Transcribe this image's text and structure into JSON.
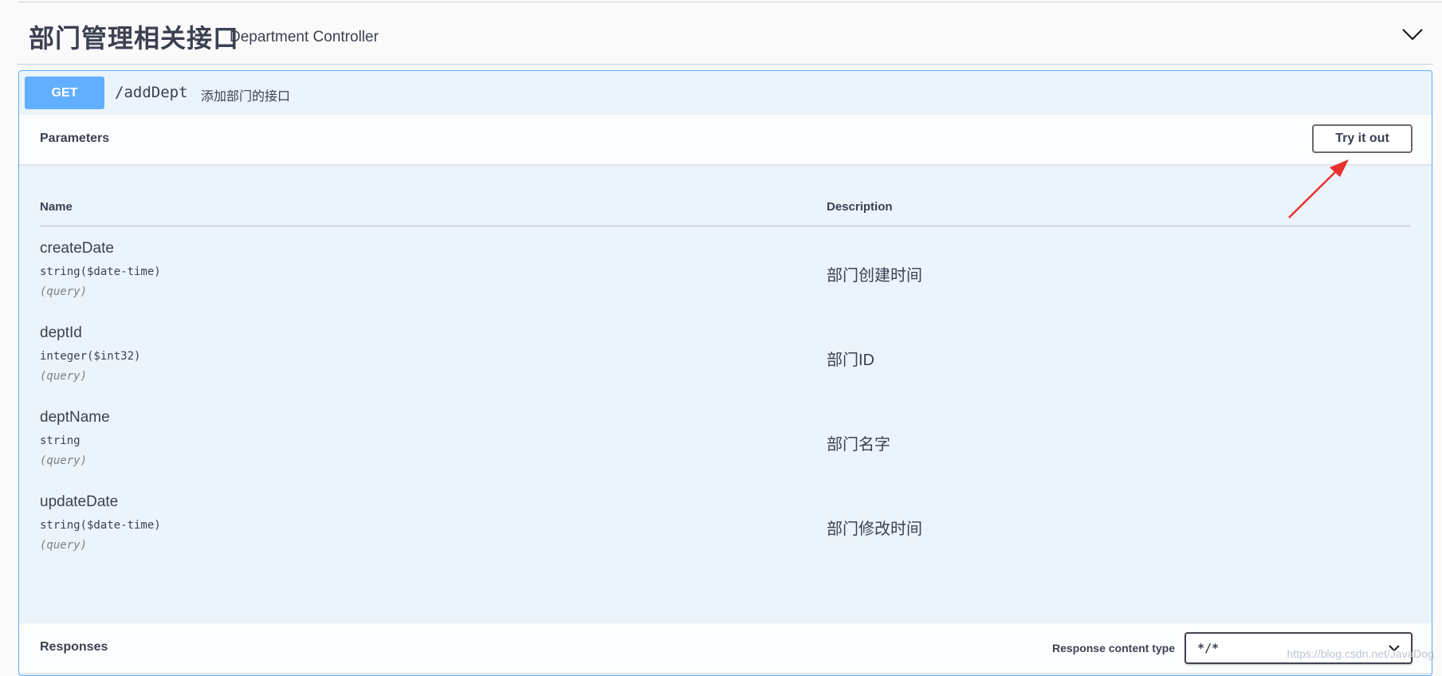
{
  "tag": {
    "title": "部门管理相关接口",
    "description": "Department Controller",
    "chevron_icon": "chevron-down-icon"
  },
  "operation": {
    "method": "GET",
    "path": "/addDept",
    "summary": "添加部门的接口"
  },
  "parameters_section": {
    "title": "Parameters",
    "try_button": "Try it out",
    "columns": {
      "name": "Name",
      "description": "Description"
    },
    "params": [
      {
        "name": "createDate",
        "type": "string($date-time)",
        "in": "(query)",
        "description": "部门创建时间"
      },
      {
        "name": "deptId",
        "type": "integer($int32)",
        "in": "(query)",
        "description": "部门ID"
      },
      {
        "name": "deptName",
        "type": "string",
        "in": "(query)",
        "description": "部门名字"
      },
      {
        "name": "updateDate",
        "type": "string($date-time)",
        "in": "(query)",
        "description": "部门修改时间"
      }
    ]
  },
  "responses_section": {
    "title": "Responses",
    "content_type_label": "Response content type",
    "content_type_value": "*/*"
  },
  "watermark": "https://blog.csdn.net/JavaDog",
  "colors": {
    "get_accent": "#61affe",
    "annotation_arrow": "#e8312f"
  }
}
